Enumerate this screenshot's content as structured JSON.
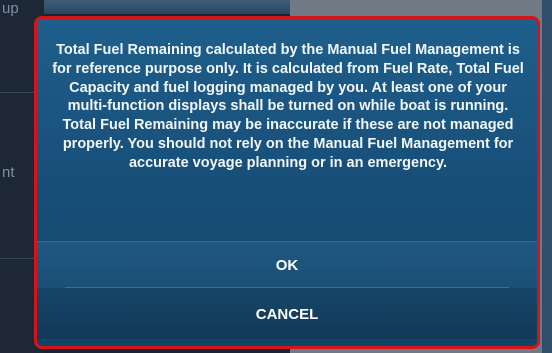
{
  "background": {
    "left_items": [
      "up",
      "nt"
    ]
  },
  "dialog": {
    "message": "Total Fuel Remaining calculated by the Manual Fuel Management is for reference purpose only. It is calculated from Fuel Rate, Total Fuel Capacity and fuel logging managed by you. At least one of your multi-function displays shall be turned on while boat is running. Total Fuel Remaining may be inaccurate if these are not managed properly. You should not rely on the Manual Fuel Management for accurate voyage planning or in an emergency.",
    "ok_label": "OK",
    "cancel_label": "CANCEL"
  },
  "colors": {
    "highlight_border": "#d4141b",
    "dialog_bg": "#1a5580"
  }
}
